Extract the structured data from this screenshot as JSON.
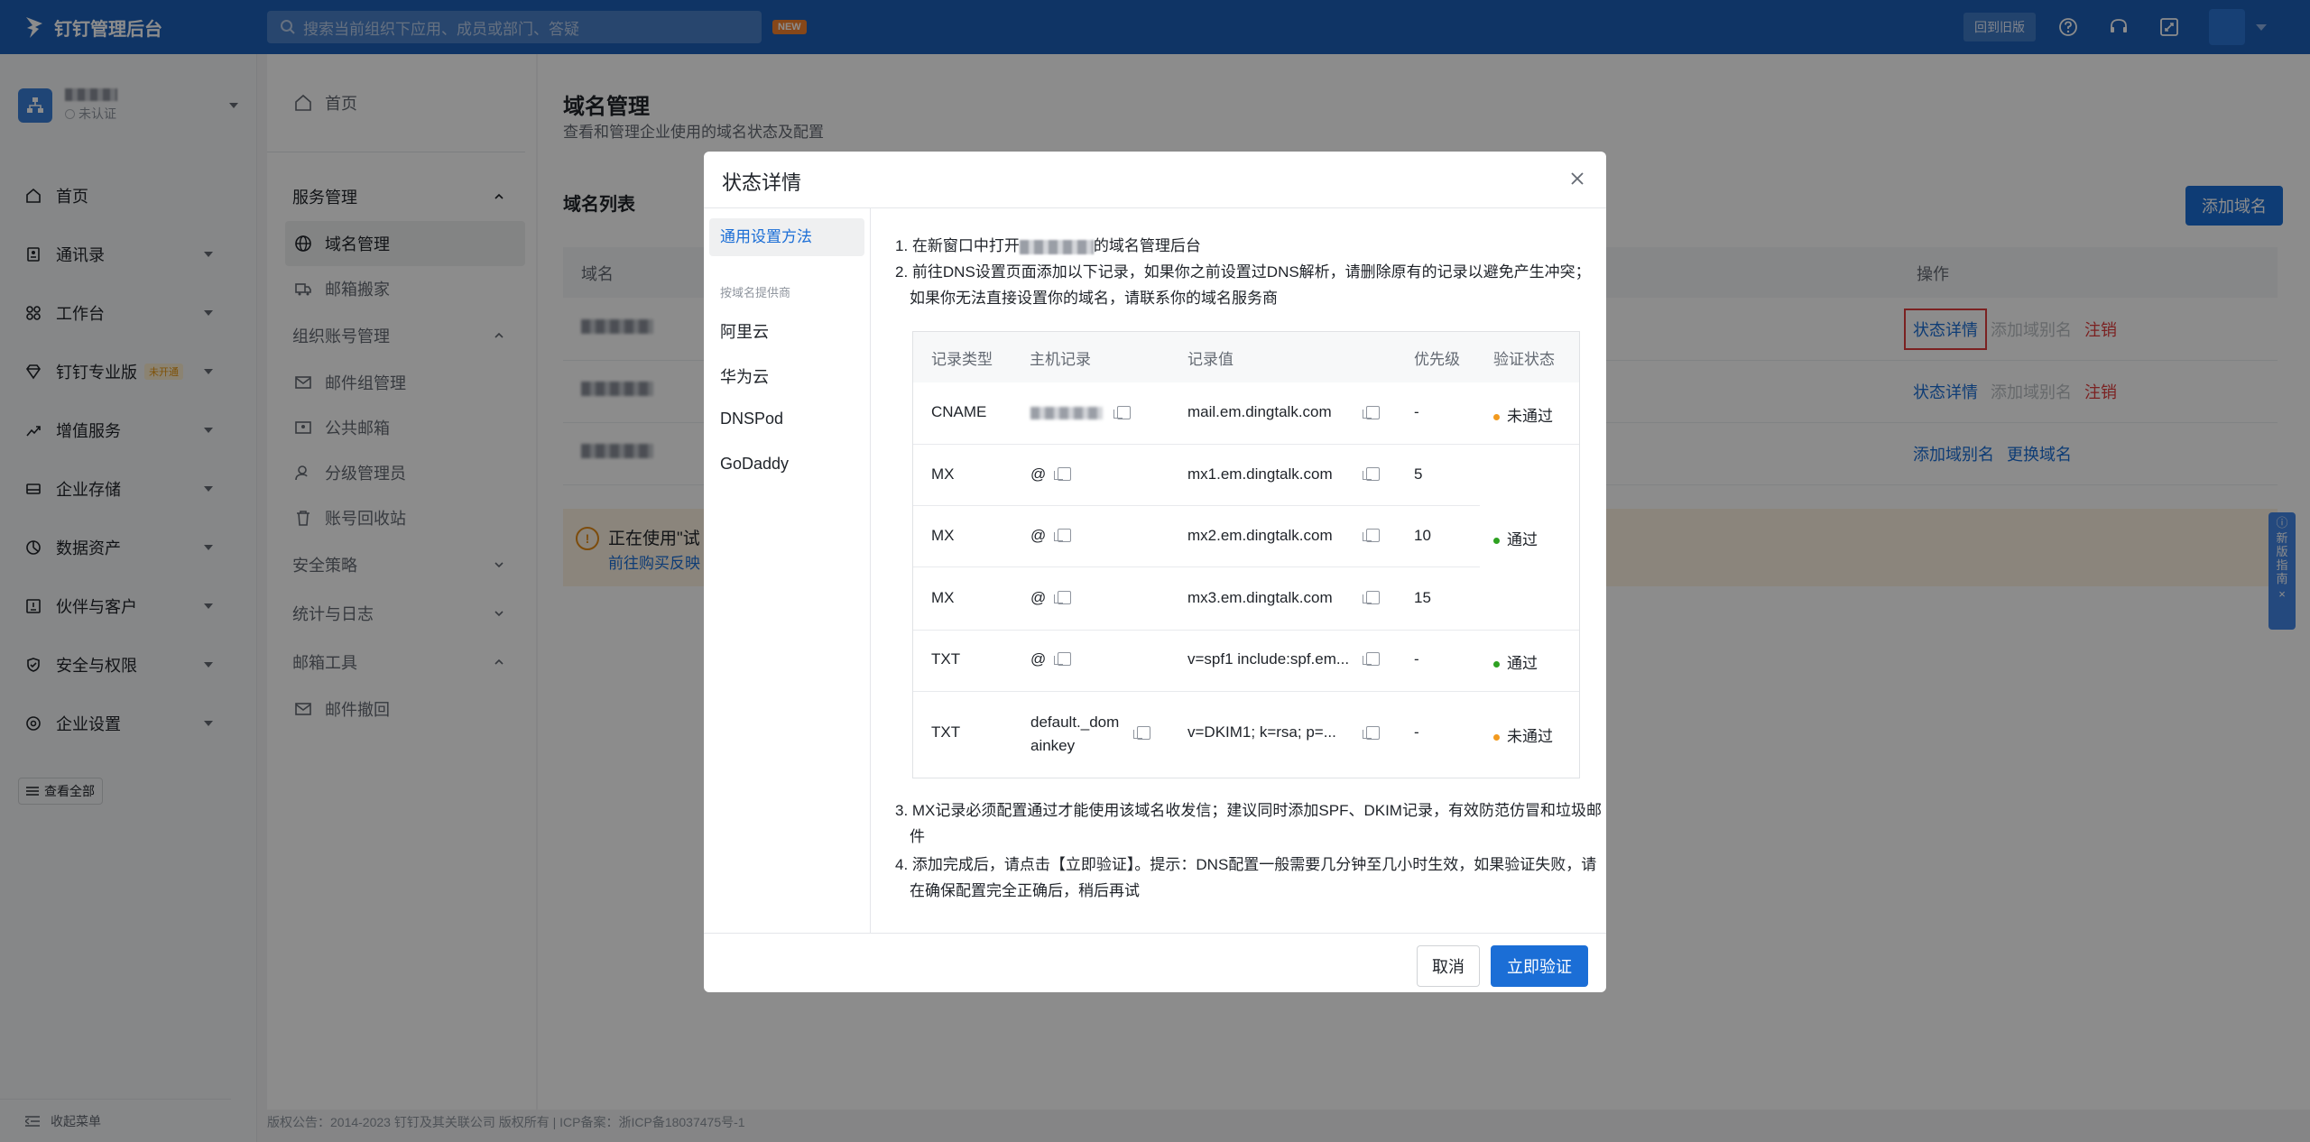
{
  "topbar": {
    "brand": "钉钉管理后台",
    "search_placeholder": "搜索当前组织下应用、成员或部门、答疑",
    "new_tag": "NEW",
    "old_version_button": "回到旧版"
  },
  "org": {
    "cert_status": "未认证"
  },
  "leftnav": {
    "items": [
      {
        "label": "首页",
        "icon": "home-icon"
      },
      {
        "label": "通讯录",
        "icon": "contacts-icon"
      },
      {
        "label": "工作台",
        "icon": "workbench-icon"
      },
      {
        "label": "钉钉专业版",
        "icon": "diamond-icon",
        "badge": "未开通"
      },
      {
        "label": "增值服务",
        "icon": "chart-icon"
      },
      {
        "label": "企业存储",
        "icon": "storage-icon"
      },
      {
        "label": "数据资产",
        "icon": "data-icon"
      },
      {
        "label": "伙伴与客户",
        "icon": "partner-icon"
      },
      {
        "label": "安全与权限",
        "icon": "shield-icon"
      },
      {
        "label": "企业设置",
        "icon": "gear-icon"
      }
    ],
    "view_all": "查看全部",
    "collapse": "收起菜单"
  },
  "subnav": {
    "home": "首页",
    "group_service": "服务管理",
    "item_domain": "域名管理",
    "item_move": "邮箱搬家",
    "group_org": "组织账号管理",
    "item_mailgroup": "邮件组管理",
    "item_public": "公共邮箱",
    "item_admin": "分级管理员",
    "item_recycle": "账号回收站",
    "group_security": "安全策略",
    "group_stats": "统计与日志",
    "group_tools": "邮箱工具",
    "item_recall": "邮件撤回"
  },
  "main": {
    "title": "域名管理",
    "subtitle": "查看和管理企业使用的域名状态及配置",
    "list_title": "域名列表",
    "add_domain": "添加域名",
    "col_domain": "域名",
    "col_ops": "操作",
    "rows": [
      {
        "op1": "状态详情",
        "op2": "添加域别名",
        "op3": "注销"
      },
      {
        "op1": "状态详情",
        "op2": "添加域别名",
        "op3": "注销"
      },
      {
        "op1": "添加域别名",
        "op2": "更换域名"
      }
    ],
    "notice_line1": "正在使用\"试",
    "notice_line2": "前往购买反映"
  },
  "guide": "新版指南",
  "footer": "版权公告：2014-2023 钉钉及其关联公司 版权所有 | ICP备案：浙ICP备18037475号-1",
  "modal": {
    "title": "状态详情",
    "tab_general": "通用设置方法",
    "by_provider": "按域名提供商",
    "providers": [
      "阿里云",
      "华为云",
      "DNSPod",
      "GoDaddy"
    ],
    "step1_pre": "1. 在新窗口中打开",
    "step1_post": "的域名管理后台",
    "step2": "2. 前往DNS设置页面添加以下记录，如果你之前设置过DNS解析，请删除原有的记录以避免产生冲突；如果你无法直接设置你的域名，请联系你的域名服务商",
    "table_headers": [
      "记录类型",
      "主机记录",
      "记录值",
      "优先级",
      "验证状态"
    ],
    "records": [
      {
        "type": "CNAME",
        "host": "",
        "value": "mail.em.dingtalk.com",
        "priority": "-",
        "status": "未通过",
        "status_color": "#f29a1f"
      },
      {
        "type": "MX",
        "host": "@",
        "value": "mx1.em.dingtalk.com",
        "priority": "5",
        "status": "",
        "status_color": ""
      },
      {
        "type": "MX",
        "host": "@",
        "value": "mx2.em.dingtalk.com",
        "priority": "10",
        "status": "通过",
        "status_color": "#2ea121"
      },
      {
        "type": "MX",
        "host": "@",
        "value": "mx3.em.dingtalk.com",
        "priority": "15",
        "status": "",
        "status_color": ""
      },
      {
        "type": "TXT",
        "host": "@",
        "value": "v=spf1 include:spf.em...",
        "priority": "-",
        "status": "通过",
        "status_color": "#2ea121"
      },
      {
        "type": "TXT",
        "host": "default._domainkey",
        "value": "v=DKIM1; k=rsa; p=...",
        "priority": "-",
        "status": "未通过",
        "status_color": "#f29a1f"
      }
    ],
    "step3": "3. MX记录必须配置通过才能使用该域名收发信；建议同时添加SPF、DKIM记录，有效防范仿冒和垃圾邮件",
    "step4": "4. 添加完成后，请点击【立即验证】。提示：DNS配置一般需要几分钟至几小时生效，如果验证失败，请在确保配置完全正确后，稍后再试",
    "cancel": "取消",
    "verify": "立即验证"
  }
}
